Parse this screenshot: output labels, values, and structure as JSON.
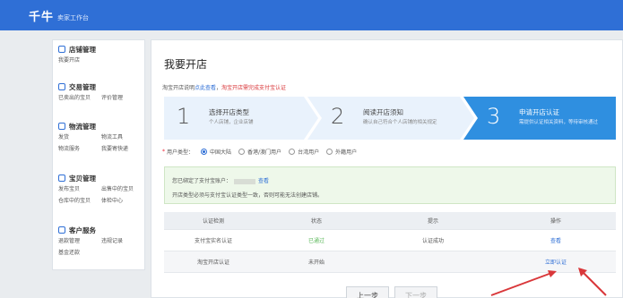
{
  "brand": {
    "logo": "千牛",
    "subtitle": "卖家工作台"
  },
  "sidebar": [
    {
      "title": "店铺管理",
      "icon": "shop-icon",
      "links": [
        "我要开店"
      ]
    },
    {
      "title": "交易管理",
      "icon": "trade-icon",
      "links": [
        "已卖出的宝贝",
        "评价管理"
      ]
    },
    {
      "title": "物流管理",
      "icon": "logistics-icon",
      "links": [
        "发货",
        "物流工具",
        "物流服务",
        "我要寄快递"
      ]
    },
    {
      "title": "宝贝管理",
      "icon": "goods-icon",
      "links": [
        "发布宝贝",
        "出售中的宝贝",
        "仓库中的宝贝",
        "体检中心"
      ]
    },
    {
      "title": "客户服务",
      "icon": "service-icon",
      "links": [
        "退款管理",
        "违规记录",
        "基金还款"
      ]
    }
  ],
  "main": {
    "title": "我要开店",
    "notice": {
      "prefix": "淘宝开店说明",
      "link": "点此查看",
      "sep": "，",
      "red": "淘宝开店需完成支付宝认证"
    },
    "steps": [
      {
        "num": "1",
        "title": "选择开店类型",
        "desc": "个人店铺，企业店铺"
      },
      {
        "num": "2",
        "title": "阅读开店须知",
        "desc": "确认自己符合个人店铺的相关规定"
      },
      {
        "num": "3",
        "title": "申请开店认证",
        "desc": "需提供认证相关资料，等待审核通过"
      }
    ],
    "active_step": 2,
    "region": {
      "label": "用户类型：",
      "options": [
        "中国大陆",
        "香港/澳门用户",
        "台湾用户",
        "外籍用户"
      ],
      "selected": 0
    },
    "bound": {
      "line1_prefix": "您已绑定了支付宝账户：",
      "line1_link": "查看",
      "line2": "开店类型必须与支付宝认证类型一致，否则可能无法创建店铺。"
    },
    "table": {
      "headers": [
        "认证检测",
        "状态",
        "提示",
        "操作"
      ],
      "rows": [
        {
          "name": "支付宝实名认证",
          "status": "已通过",
          "status_color": "green",
          "tip": "认证成功",
          "action": "查看"
        },
        {
          "name": "淘宝开店认证",
          "status": "未开始",
          "status_color": "",
          "tip": "",
          "action": "立即认证"
        }
      ]
    },
    "buttons": {
      "prev": "上一步",
      "next": "下一步"
    }
  },
  "colors": {
    "brand_blue": "#2f6fd6",
    "active_step": "#2f8fe0",
    "step_bg": "#e9f2fc",
    "success_green": "#5bb85a",
    "annotation_red": "#d9373a"
  }
}
